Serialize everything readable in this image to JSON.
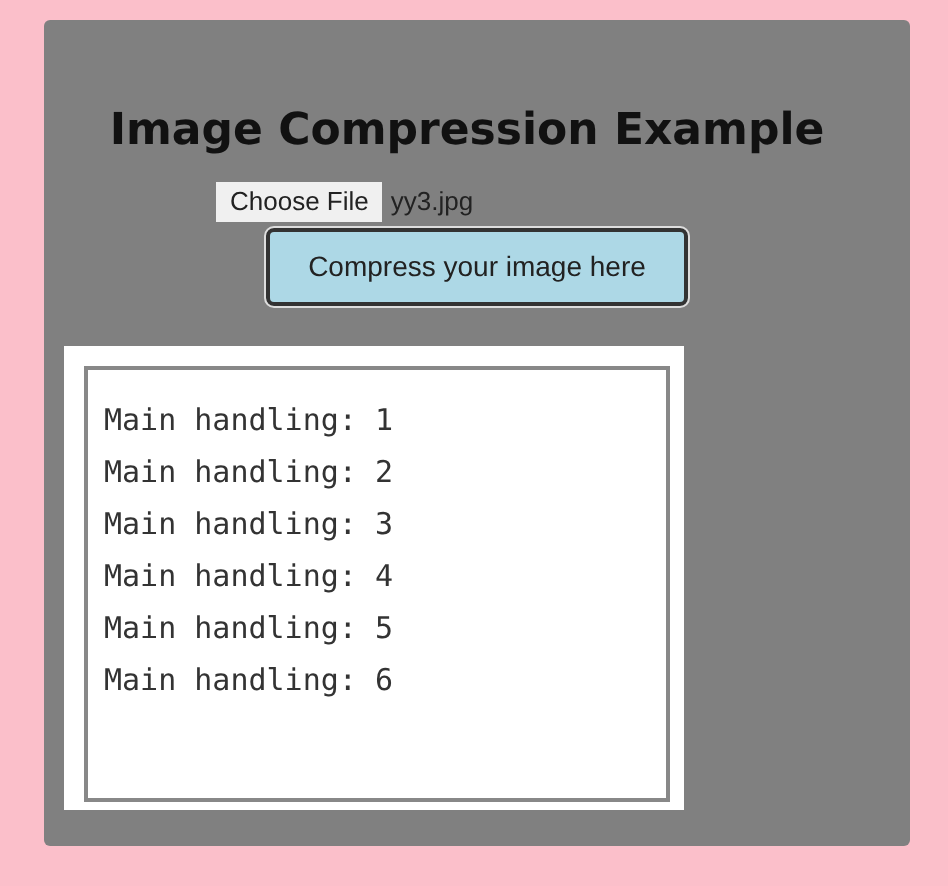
{
  "title": "Image Compression Example",
  "file_input": {
    "button": "Choose File",
    "file_name": "yy3.jpg"
  },
  "compress_button": "Compress your image here",
  "output_lines": [
    "Main handling: 1",
    "Main handling: 2",
    "Main handling: 3",
    "Main handling: 4",
    "Main handling: 5",
    "Main handling: 6"
  ]
}
